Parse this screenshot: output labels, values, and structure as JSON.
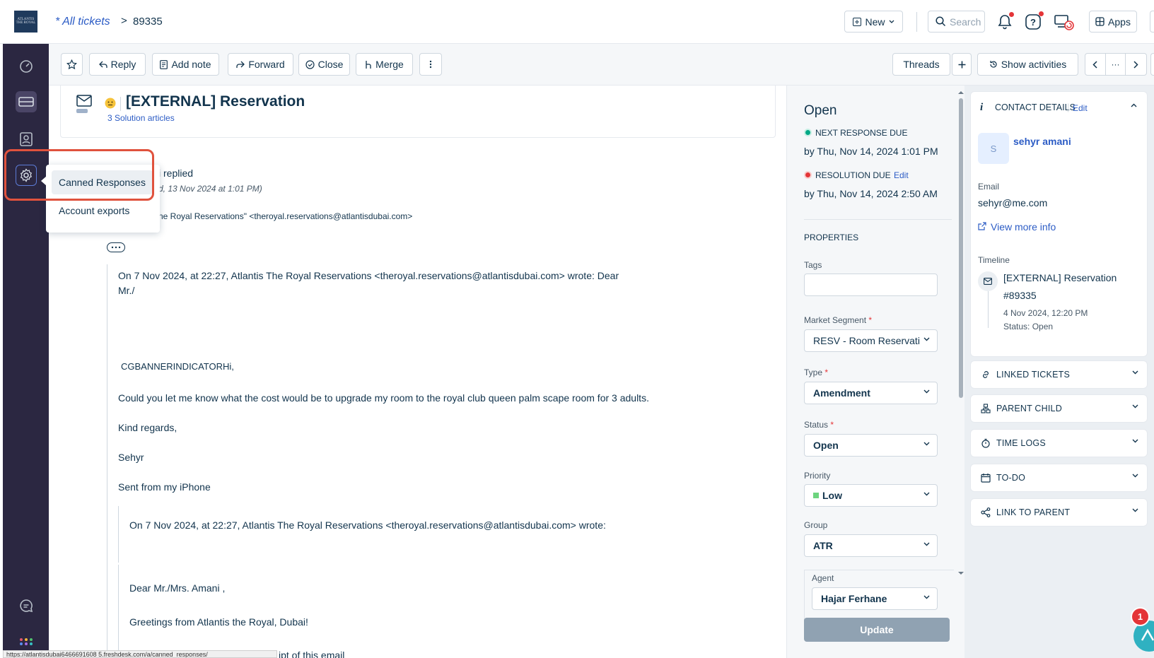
{
  "header": {
    "logo_text": "ATLANTIS THE ROYAL",
    "breadcrumb_all": "* All tickets",
    "breadcrumb_separator": ">",
    "ticket_id": "89335",
    "new_label": "New",
    "search_placeholder": "Search",
    "apps_label": "Apps"
  },
  "toolbar": {
    "reply": "Reply",
    "add_note": "Add note",
    "forward": "Forward",
    "close": "Close",
    "merge": "Merge",
    "threads": "Threads",
    "show_activities": "Show activities",
    "more": "···"
  },
  "settings_menu": {
    "items": [
      "Canned Responses",
      "Account exports"
    ]
  },
  "ticket": {
    "subject": "[EXTERNAL] Reservation",
    "solution_articles": "3 Solution articles",
    "replied_suffix": "i replied",
    "replied_date": "d, 13 Nov 2024 at 1:01 PM)",
    "from_line": "ne Royal Reservations\" <theroyal.reservations@atlantisdubai.com>",
    "body": {
      "quote_header": "On 7 Nov 2024, at 22:27, Atlantis The Royal Reservations <theroyal.reservations@atlantisdubai.com> wrote: Dear",
      "quote_header_2": "Mr./",
      "banner": "CGBANNERINDICATORHi,",
      "line1": "Could you let me know what the cost would be to upgrade my room to the royal club queen palm scape room for 3 adults.",
      "line2": "Kind regards,",
      "line3": "Sehyr",
      "line4": "Sent from my iPhone",
      "nested_header": "On 7 Nov 2024, at 22:27, Atlantis The Royal Reservations <theroyal.reservations@atlantisdubai.com> wrote:",
      "dear": "Dear Mr./Mrs. Amani ,",
      "greetings": "Greetings from Atlantis the Royal, Dubai!",
      "receipt_partial": "ipt of this email"
    }
  },
  "properties": {
    "status_title": "Open",
    "next_response_label": "NEXT RESPONSE DUE",
    "next_response_value": "by Thu, Nov 14, 2024 1:01 PM",
    "resolution_label": "RESOLUTION DUE",
    "resolution_edit": "Edit",
    "resolution_value": "by Thu, Nov 14, 2024 2:50 AM",
    "section_title": "PROPERTIES",
    "tags_label": "Tags",
    "market_segment_label": "Market Segment",
    "market_segment_value": "RESV - Room Reservation",
    "type_label": "Type",
    "type_value": "Amendment",
    "status_label": "Status",
    "status_value": "Open",
    "priority_label": "Priority",
    "priority_value": "Low",
    "group_label": "Group",
    "group_value": "ATR",
    "agent_label": "Agent",
    "agent_value": "Hajar Ferhane",
    "update_button": "Update",
    "required_mark": "*",
    "colors": {
      "next_response_dot": "#00a886",
      "resolution_dot": "#e43538",
      "priority_low": "#6dd47e"
    }
  },
  "contact": {
    "header": "CONTACT DETAILS",
    "edit": "Edit",
    "avatar_initial": "S",
    "name": "sehyr amani",
    "email_label": "Email",
    "email": "sehyr@me.com",
    "view_more": "View more info",
    "timeline_label": "Timeline",
    "timeline_title": "[EXTERNAL] Reservation",
    "timeline_id": "#89335",
    "timeline_date": "4 Nov 2024, 12:20 PM",
    "timeline_status": "Status: Open",
    "sections": [
      "LINKED TICKETS",
      "PARENT CHILD",
      "TIME LOGS",
      "TO-DO",
      "LINK TO PARENT"
    ]
  },
  "widget": {
    "badge_count": "1"
  },
  "statusbar": {
    "url": "https://atlantisdubai6466691608 5.freshdesk.com/a/canned_responses/"
  }
}
